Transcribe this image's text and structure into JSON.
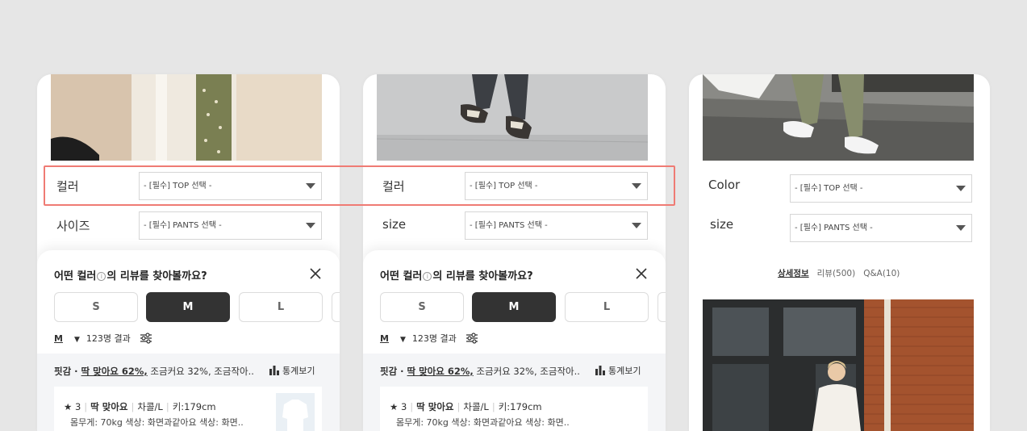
{
  "cards": [
    {
      "color_label": "컬러",
      "size_label": "사이즈",
      "color_select": "- [필수] TOP 선택 -",
      "size_select": "- [필수] PANTS 선택 -",
      "sheet": {
        "title_a": "어떤 컬러",
        "info_glyph": "i",
        "title_b": "의 리뷰를 찾아볼까요?",
        "sizes": [
          "S",
          "M",
          "L"
        ],
        "active_size": "M",
        "filter_selected": "M",
        "result_count": "123명 결과",
        "fit_prefix": "핏감 · ",
        "fit_main": "딱 맞아요 62%,",
        "fit_rest": " 조금커요 32%,  조금작아..",
        "stats_label": "통계보기",
        "review": {
          "rating": "★ 3",
          "verdict": "딱 맞아요",
          "variant": "차콜/L",
          "height": "키:179cm",
          "detail": "몸무게: 70kg   색상: 화면과같아요    색상: 화면.."
        }
      }
    },
    {
      "color_label": "컬러",
      "size_label": "size",
      "color_select": "- [필수] TOP 선택 -",
      "size_select": "- [필수] PANTS 선택 -",
      "sheet": {
        "title_a": "어떤 컬러",
        "info_glyph": "i",
        "title_b": "의 리뷰를 찾아볼까요?",
        "sizes": [
          "S",
          "M",
          "L"
        ],
        "active_size": "M",
        "filter_selected": "M",
        "result_count": "123명 결과",
        "fit_prefix": "핏감 · ",
        "fit_main": "딱 맞아요 62%,",
        "fit_rest": " 조금커요 32%,  조금작아..",
        "stats_label": "통계보기",
        "review": {
          "rating": "★ 3",
          "verdict": "딱 맞아요",
          "variant": "차콜/L",
          "height": "키:179cm",
          "detail": "몸무게: 70kg   색상: 화면과같아요    색상: 화면.."
        }
      }
    },
    {
      "color_label": "Color",
      "size_label": "size",
      "color_select": "- [필수] TOP 선택 -",
      "size_select": "- [필수] PANTS 선택 -",
      "tabs": [
        "상세정보",
        "리뷰(500)",
        "Q&A(10)"
      ]
    }
  ],
  "colors": {
    "background": "#e6e6e6",
    "highlight": "#ef7b74",
    "active_size_bg": "#333333"
  }
}
